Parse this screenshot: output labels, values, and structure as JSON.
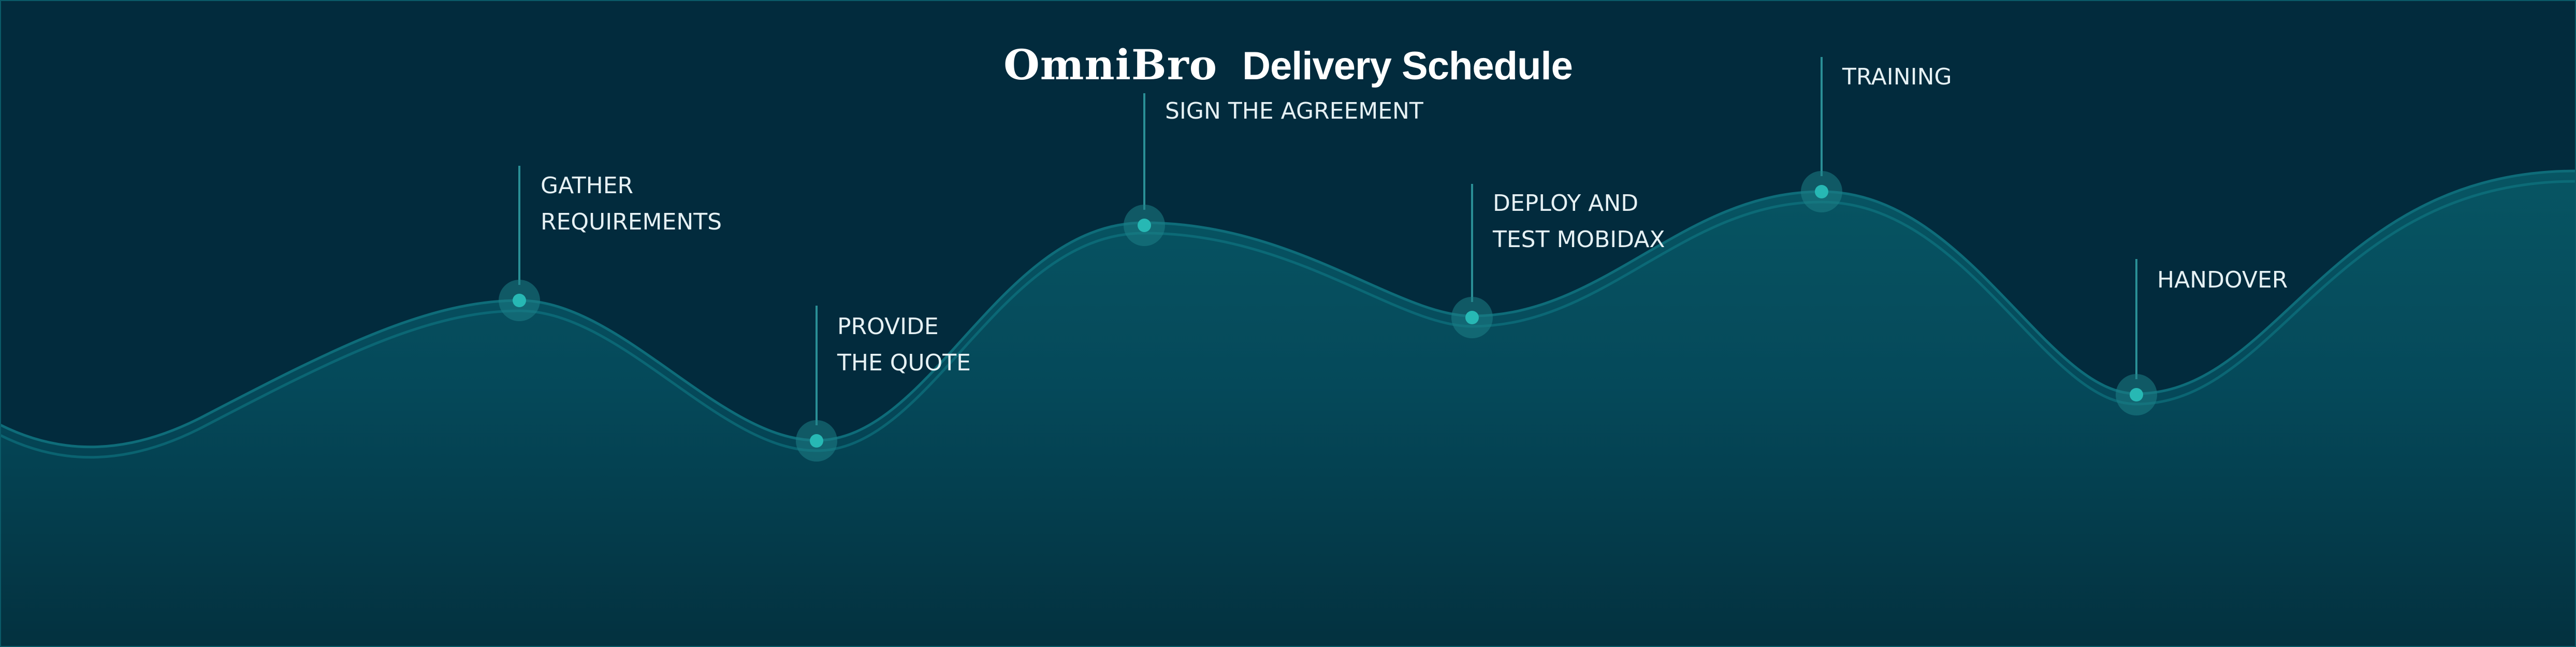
{
  "header": {
    "brand": "OmniBro",
    "title": "Delivery Schedule"
  },
  "steps": [
    {
      "lines": [
        "GATHER",
        "REQUIREMENTS"
      ]
    },
    {
      "lines": [
        "PROVIDE",
        "THE QUOTE"
      ]
    },
    {
      "lines": [
        "SIGN THE AGREEMENT"
      ]
    },
    {
      "lines": [
        "DEPLOY AND",
        "TEST MOBIDAX"
      ]
    },
    {
      "lines": [
        "TRAINING"
      ]
    },
    {
      "lines": [
        "HANDOVER"
      ]
    }
  ],
  "colors": {
    "background": "#022b3d",
    "wave_fill_top": "#075563",
    "wave_fill_bottom": "#03313f",
    "wave_line": "#117d89",
    "marker": "#27b8b4",
    "marker_halo": "#1e7f86",
    "connector": "#2a8f96",
    "text": "#e6f1f4"
  }
}
